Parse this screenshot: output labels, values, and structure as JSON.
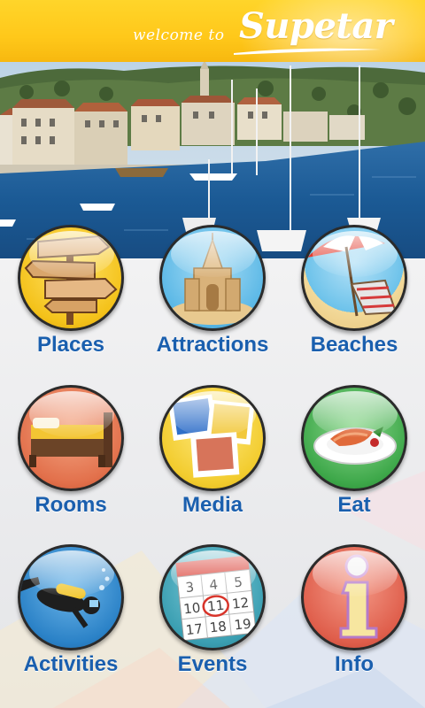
{
  "header": {
    "welcome_text": "welcome to",
    "brand": "Supetar"
  },
  "colors": {
    "header_yellow": "#ffc81a",
    "label_blue": "#1a5fae"
  },
  "menu": {
    "items": [
      {
        "label": "Places",
        "icon": "signpost-icon"
      },
      {
        "label": "Attractions",
        "icon": "sand-castle-icon"
      },
      {
        "label": "Beaches",
        "icon": "beach-umbrella-icon"
      },
      {
        "label": "Rooms",
        "icon": "bed-icon"
      },
      {
        "label": "Media",
        "icon": "photos-icon"
      },
      {
        "label": "Eat",
        "icon": "food-plate-icon"
      },
      {
        "label": "Activities",
        "icon": "diver-icon"
      },
      {
        "label": "Events",
        "icon": "calendar-icon"
      },
      {
        "label": "Info",
        "icon": "info-icon"
      }
    ]
  },
  "calendar": {
    "days": [
      "3",
      "4",
      "5",
      "10",
      "11",
      "12",
      "17",
      "18",
      "19"
    ],
    "highlighted": "11"
  }
}
